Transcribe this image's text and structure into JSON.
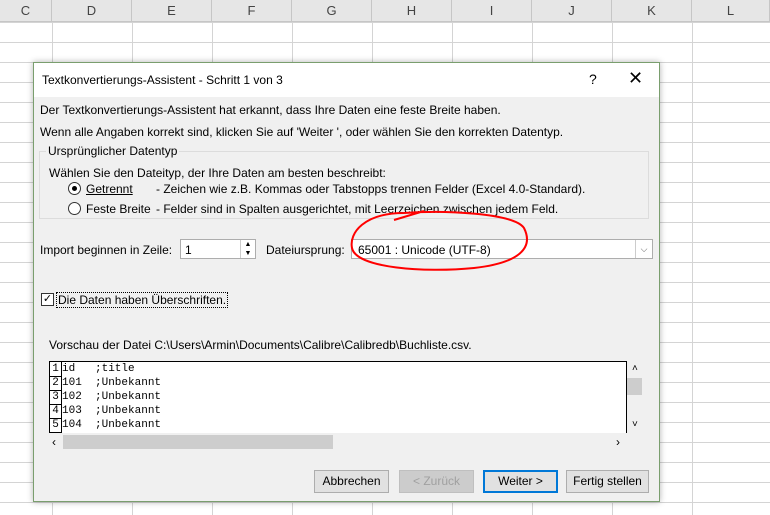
{
  "excel": {
    "columns": [
      "C",
      "D",
      "E",
      "F",
      "G",
      "H",
      "I",
      "J",
      "K",
      "L"
    ]
  },
  "dialog": {
    "title": "Textkonvertierungs-Assistent - Schritt 1 von 3",
    "help": "?",
    "close": "✕",
    "intro1": "Der Textkonvertierungs-Assistent hat erkannt, dass Ihre Daten eine feste Breite haben.",
    "intro2": "Wenn alle Angaben korrekt sind, klicken Sie auf 'Weiter ', oder wählen Sie den korrekten Datentyp.",
    "group_label": "Ursprünglicher Datentyp",
    "group_prompt": "Wählen Sie den Dateityp, der Ihre Daten am besten beschreibt:",
    "options": [
      {
        "label": "Getrennt",
        "desc": "- Zeichen wie z.B. Kommas oder Tabstopps trennen Felder (Excel 4.0-Standard).",
        "selected": true
      },
      {
        "label": "Feste Breite",
        "desc": "- Felder sind in Spalten ausgerichtet, mit Leerzeichen zwischen jedem Feld.",
        "selected": false
      }
    ],
    "start_row_label": "Import beginnen in Zeile:",
    "start_row_value": "1",
    "origin_label": "Dateiursprung:",
    "origin_value": "65001 : Unicode (UTF-8)",
    "headers_checkbox": "Die Daten haben Überschriften.",
    "headers_checked": true,
    "preview_label": "Vorschau der Datei C:\\Users\\Armin\\Documents\\Calibre\\Calibredb\\Buchliste.csv.",
    "preview_rows": [
      {
        "n": "1",
        "text": "id   ;title"
      },
      {
        "n": "2",
        "text": "101  ;Unbekannt"
      },
      {
        "n": "3",
        "text": "102  ;Unbekannt"
      },
      {
        "n": "4",
        "text": "103  ;Unbekannt"
      },
      {
        "n": "5",
        "text": "104  ;Unbekannt"
      }
    ],
    "buttons": {
      "cancel": "Abbrechen",
      "back": "< Zurück",
      "next": "Weiter >",
      "finish": "Fertig stellen"
    }
  },
  "annotation_color": "#ff0000"
}
